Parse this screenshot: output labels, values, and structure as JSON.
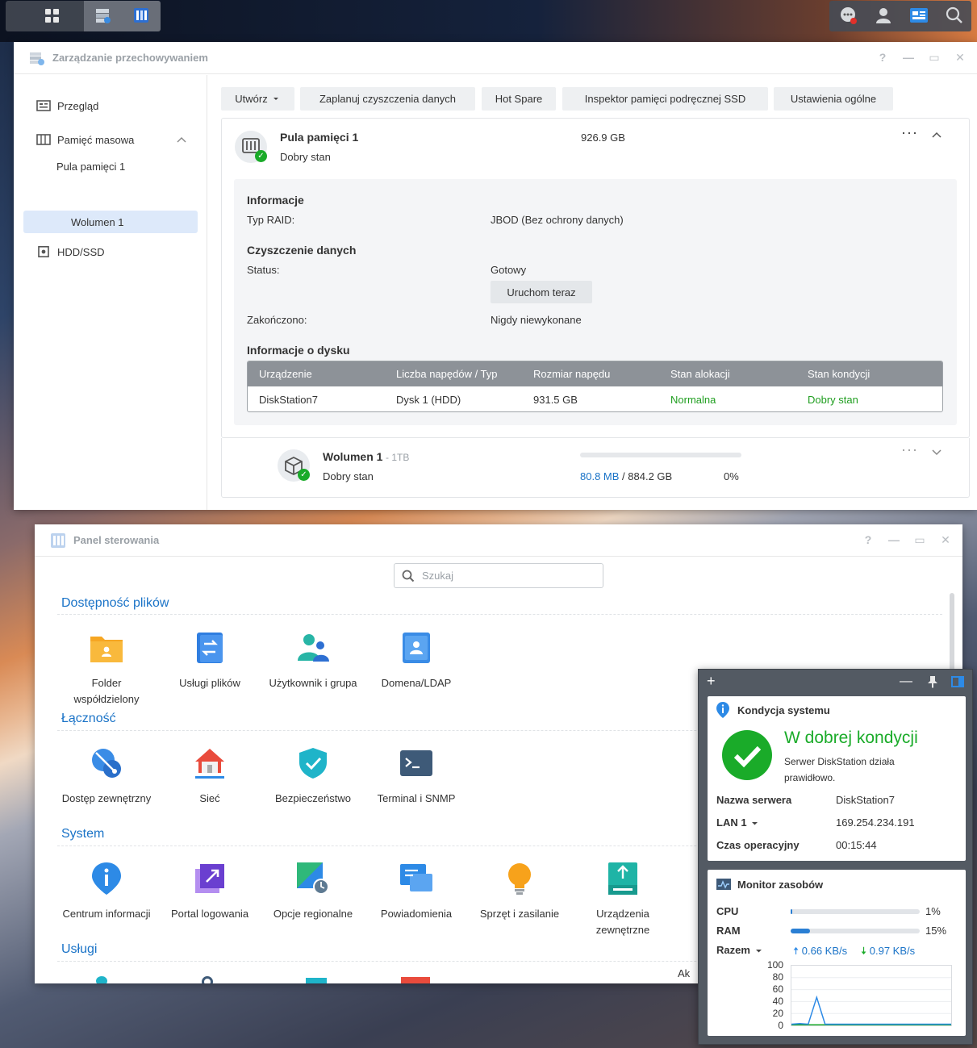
{
  "storage_manager": {
    "title": "Zarządzanie przechowywaniem",
    "nav": {
      "overview": "Przegląd",
      "storage": "Pamięć masowa",
      "pool": "Pula pamięci 1",
      "volume": "Wolumen 1",
      "hdd": "HDD/SSD"
    },
    "toolbar": [
      "Utwórz",
      "Zaplanuj czyszczenia danych",
      "Hot Spare",
      "Inspektor pamięci podręcznej SSD",
      "Ustawienia ogólne"
    ],
    "pool": {
      "name": "Pula pamięci 1",
      "status": "Dobry stan",
      "size": "926.9 GB",
      "info_heading": "Informacje",
      "raid_label": "Typ RAID:",
      "raid_value": "JBOD (Bez ochrony danych)",
      "scrub_heading": "Czyszczenie danych",
      "status_label": "Status:",
      "status_value": "Gotowy",
      "run_now": "Uruchom teraz",
      "finished_label": "Zakończono:",
      "finished_value": "Nigdy niewykonane",
      "disk_heading": "Informacje o dysku",
      "table_headers": [
        "Urządzenie",
        "Liczba napędów / Typ",
        "Rozmiar napędu",
        "Stan alokacji",
        "Stan kondycji"
      ],
      "table_row": [
        "DiskStation7",
        "Dysk 1 (HDD)",
        "931.5 GB",
        "Normalna",
        "Dobry stan"
      ]
    },
    "volume": {
      "name": "Wolumen 1",
      "size_suffix": "- 1TB",
      "status": "Dobry stan",
      "used": "80.8 MB",
      "total": "/ 884.2 GB",
      "percent": "0%",
      "usage_fraction": 0.0
    }
  },
  "control_panel": {
    "title": "Panel sterowania",
    "search_placeholder": "Szukaj",
    "sections": [
      {
        "title": "Dostępność plików",
        "items": [
          "Folder współdzielony",
          "Usługi plików",
          "Użytkownik i grupa",
          "Domena/LDAP"
        ]
      },
      {
        "title": "Łączność",
        "items": [
          "Dostęp zewnętrzny",
          "Sieć",
          "Bezpieczeństwo",
          "Terminal i SNMP"
        ]
      },
      {
        "title": "System",
        "items": [
          "Centrum informacji",
          "Portal logowania",
          "Opcje regionalne",
          "Powiadomienia",
          "Sprzęt i zasilanie",
          "Urządzenia zewnętrzne",
          "Ak\npr"
        ]
      },
      {
        "title": "Usługi",
        "items": []
      }
    ]
  },
  "widgets": {
    "health": {
      "title": "Kondycja systemu",
      "headline": "W dobrej kondycji",
      "desc": "Serwer DiskStation działa prawidłowo.",
      "server_label": "Nazwa serwera",
      "server_value": "DiskStation7",
      "lan_label": "LAN 1",
      "lan_value": "169.254.234.191",
      "uptime_label": "Czas operacyjny",
      "uptime_value": "00:15:44"
    },
    "monitor": {
      "title": "Monitor zasobów",
      "cpu_label": "CPU",
      "cpu_value": "1%",
      "cpu_fraction": 0.01,
      "ram_label": "RAM",
      "ram_value": "15%",
      "ram_fraction": 0.15,
      "net_label": "Razem",
      "upload": "0.66 KB/s",
      "download": "0.97 KB/s",
      "y_ticks": [
        "100",
        "80",
        "60",
        "40",
        "20",
        "0"
      ],
      "series_up": [
        2,
        3,
        2,
        47,
        2,
        2,
        2,
        2,
        2,
        2,
        2,
        2,
        2,
        2,
        2,
        2,
        2,
        2,
        2,
        2
      ],
      "series_down": [
        1,
        1,
        1,
        1,
        1,
        1,
        1,
        1,
        1,
        1,
        1,
        1,
        1,
        1,
        1,
        1,
        1,
        1,
        1,
        1
      ]
    }
  },
  "colors": {
    "accent": "#1a73c7",
    "ok": "#1aab29",
    "title_bar": "#9aa0a6"
  }
}
